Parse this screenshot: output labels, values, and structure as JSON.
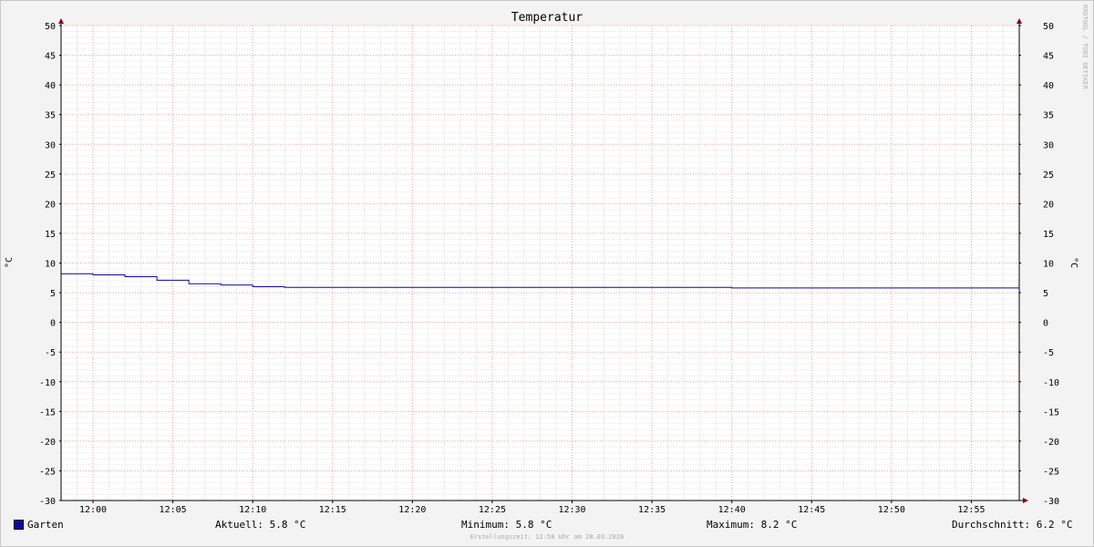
{
  "chart_data": {
    "type": "line",
    "title": "Temperatur",
    "ylabel": "°C",
    "ylim": [
      -30,
      50
    ],
    "y_ticks": [
      50,
      45,
      40,
      35,
      30,
      25,
      20,
      15,
      10,
      5,
      0,
      -5,
      -10,
      -15,
      -20,
      -25,
      -30
    ],
    "x_range_minutes": [
      "11:58",
      "12:58"
    ],
    "x_ticks": [
      "12:00",
      "12:05",
      "12:10",
      "12:15",
      "12:20",
      "12:25",
      "12:30",
      "12:35",
      "12:40",
      "12:45",
      "12:50",
      "12:55"
    ],
    "grid": true,
    "series": [
      {
        "name": "Garten",
        "color": "#0a0aa0",
        "points": [
          {
            "t": "11:58",
            "v": 8.2
          },
          {
            "t": "12:00",
            "v": 8.0
          },
          {
            "t": "12:02",
            "v": 7.7
          },
          {
            "t": "12:04",
            "v": 7.1
          },
          {
            "t": "12:06",
            "v": 6.5
          },
          {
            "t": "12:08",
            "v": 6.3
          },
          {
            "t": "12:10",
            "v": 6.0
          },
          {
            "t": "12:12",
            "v": 5.9
          },
          {
            "t": "12:40",
            "v": 5.8
          },
          {
            "t": "12:58",
            "v": 5.8
          }
        ]
      }
    ]
  },
  "legend": {
    "series_name": "Garten",
    "current": "Aktuell: 5.8 °C",
    "minimum": "Minimum: 5.8 °C",
    "maximum": "Maximum: 8.2 °C",
    "average": "Durchschnitt: 6.2 °C"
  },
  "watermark": "RRDTOOL / TOBI OETIKER",
  "footer": "Erstellungszeit: 12:58 Uhr am 28.03.2026"
}
